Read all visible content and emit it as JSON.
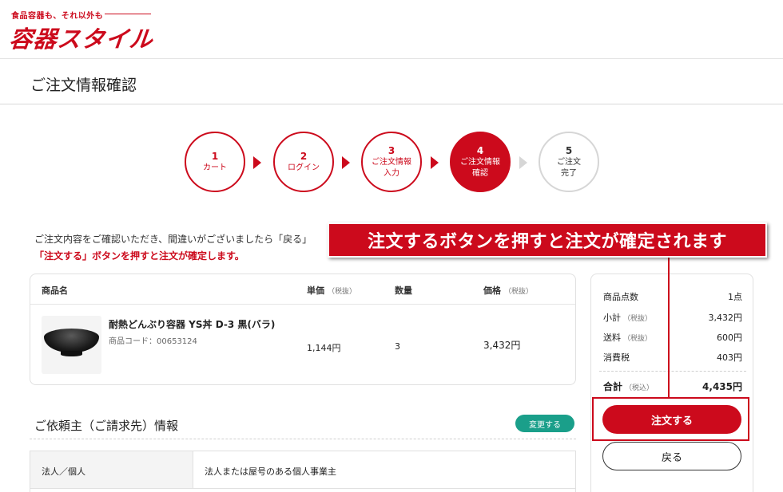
{
  "header": {
    "tagline": "食品容器も、それ以外も",
    "logo": "容器スタイル"
  },
  "page": {
    "title": "ご注文情報確認"
  },
  "steps": [
    {
      "num": "1",
      "label": "カート",
      "label2": ""
    },
    {
      "num": "2",
      "label": "ログイン",
      "label2": ""
    },
    {
      "num": "3",
      "label": "ご注文情報",
      "label2": "入力"
    },
    {
      "num": "4",
      "label": "ご注文情報",
      "label2": "確認"
    },
    {
      "num": "5",
      "label": "ご注文",
      "label2": "完了"
    }
  ],
  "intro": {
    "line1": "ご注文内容をご確認いただき、間違いがございましたら「戻る」",
    "line2": "「注文する」ボタンを押すと注文が確定します。"
  },
  "callout": {
    "text": "注文するボタンを押すと注文が確定されます"
  },
  "cart": {
    "headers": {
      "name": "商品名",
      "unit_price": "単価",
      "unit_price_note": "（税抜）",
      "qty": "数量",
      "price": "価格",
      "price_note": "（税抜）"
    },
    "items": [
      {
        "name": "耐熱どんぶり容器 YS丼 D-3 黒(バラ)",
        "code": "商品コード：00653124",
        "unit_price": "1,144円",
        "qty": "3",
        "price": "3,432円"
      }
    ]
  },
  "requester": {
    "title": "ご依頼主（ご請求先）情報",
    "edit_label": "変更する",
    "rows": [
      {
        "label": "法人／個人",
        "value": "法人または屋号のある個人事業主"
      }
    ]
  },
  "summary": {
    "count_label": "商品点数",
    "count_value": "1点",
    "subtotal_label": "小計",
    "subtotal_note": "（税抜）",
    "subtotal_value": "3,432円",
    "shipping_label": "送料",
    "shipping_note": "（税抜）",
    "shipping_value": "600円",
    "tax_label": "消費税",
    "tax_value": "403円",
    "total_label": "合計",
    "total_note": "（税込）",
    "total_value": "4,435円",
    "order_button": "注文する",
    "back_button": "戻る"
  },
  "colors": {
    "brand_red": "#cc0a1c",
    "teal": "#1a9f8a"
  }
}
